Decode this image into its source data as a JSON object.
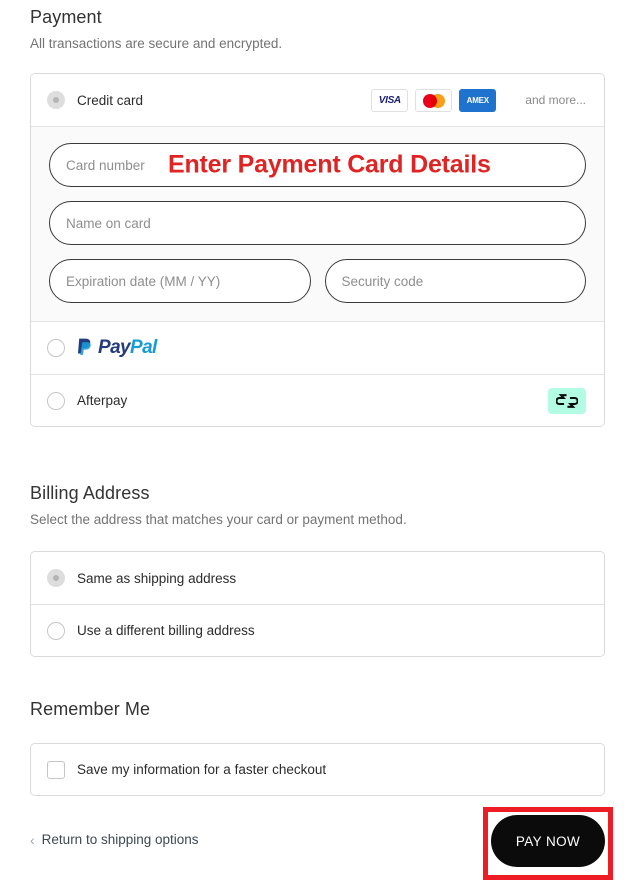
{
  "payment": {
    "title": "Payment",
    "subtitle": "All transactions are secure and encrypted.",
    "credit_card": {
      "label": "Credit card",
      "selected": true,
      "brands": [
        {
          "name": "visa-logo",
          "text": "VISA"
        },
        {
          "name": "mastercard-logo",
          "text": ""
        },
        {
          "name": "amex-logo",
          "text": "AMEX"
        }
      ],
      "and_more": "and more...",
      "fields": {
        "card_number_placeholder": "Card number",
        "name_on_card_placeholder": "Name on card",
        "expiration_placeholder": "Expiration date (MM / YY)",
        "security_code_placeholder": "Security code"
      },
      "annotation": "Enter Payment Card Details",
      "annotation_color": "#e02424"
    },
    "paypal": {
      "label": "PayPal",
      "word_pay": "Pay",
      "word_pal": "Pal",
      "selected": false
    },
    "afterpay": {
      "label": "Afterpay",
      "selected": false,
      "badge_color": "#b2fce4"
    }
  },
  "billing": {
    "title": "Billing Address",
    "subtitle": "Select the address that matches your card or payment method.",
    "options": [
      {
        "label": "Same as shipping address",
        "selected": true
      },
      {
        "label": "Use a different billing address",
        "selected": false
      }
    ]
  },
  "remember": {
    "title": "Remember Me",
    "option": {
      "label": "Save my information for a faster checkout",
      "checked": false
    }
  },
  "footer": {
    "return_link": "Return to shipping options",
    "chevron": "‹",
    "pay_now_label": "PAY NOW",
    "highlight_color": "#ee1c25"
  }
}
